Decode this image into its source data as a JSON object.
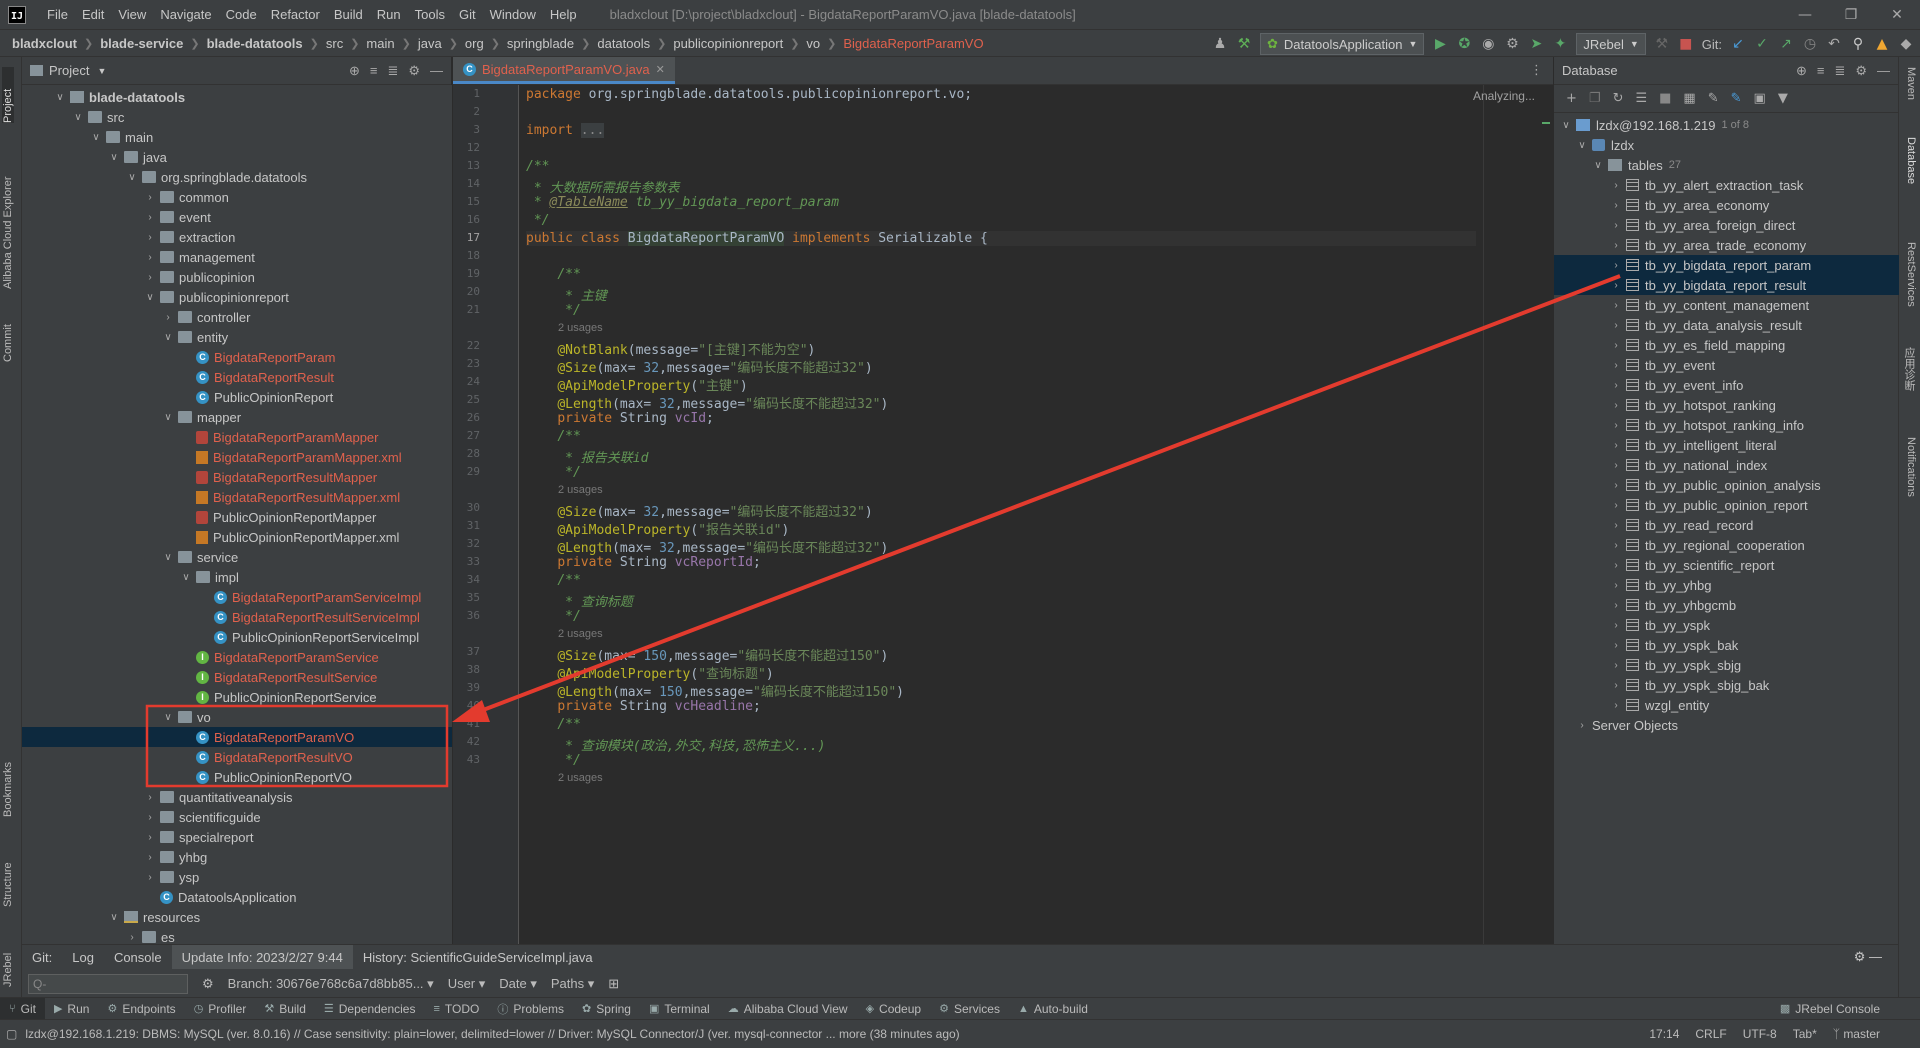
{
  "window": {
    "menu": [
      "File",
      "Edit",
      "View",
      "Navigate",
      "Code",
      "Refactor",
      "Build",
      "Run",
      "Tools",
      "Git",
      "Window",
      "Help"
    ],
    "title": "bladxclout [D:\\project\\bladxclout] - BigdataReportParamVO.java [blade-datatools]"
  },
  "breadcrumbs": [
    "bladxclout",
    "blade-service",
    "blade-datatools",
    "src",
    "main",
    "java",
    "org",
    "springblade",
    "datatools",
    "publicopinionreport",
    "vo",
    "BigdataReportParamVO"
  ],
  "toolbar": {
    "run_config": "DatatoolsApplication",
    "jrebel": "JRebel",
    "git_label": "Git:"
  },
  "left_strip": [
    "Project",
    "Alibaba Cloud Explorer",
    "Commit",
    "Bookmarks",
    "Structure",
    "JRebel"
  ],
  "right_strip": [
    "Maven",
    "Database",
    "RestServices",
    "应用诊断",
    "Notifications"
  ],
  "project": {
    "header": "Project",
    "tree": [
      {
        "label": "blade-datatools",
        "depth": 2,
        "arrow": "open",
        "icon": "module",
        "bold": true
      },
      {
        "label": "src",
        "depth": 3,
        "arrow": "open",
        "icon": "folder"
      },
      {
        "label": "main",
        "depth": 4,
        "arrow": "open",
        "icon": "folder"
      },
      {
        "label": "java",
        "depth": 5,
        "arrow": "open",
        "icon": "folder"
      },
      {
        "label": "org.springblade.datatools",
        "depth": 6,
        "arrow": "open",
        "icon": "package"
      },
      {
        "label": "common",
        "depth": 7,
        "arrow": "closed",
        "icon": "package"
      },
      {
        "label": "event",
        "depth": 7,
        "arrow": "closed",
        "icon": "package"
      },
      {
        "label": "extraction",
        "depth": 7,
        "arrow": "closed",
        "icon": "package"
      },
      {
        "label": "management",
        "depth": 7,
        "arrow": "closed",
        "icon": "package"
      },
      {
        "label": "publicopinion",
        "depth": 7,
        "arrow": "closed",
        "icon": "package"
      },
      {
        "label": "publicopinionreport",
        "depth": 7,
        "arrow": "open",
        "icon": "package"
      },
      {
        "label": "controller",
        "depth": 8,
        "arrow": "closed",
        "icon": "package"
      },
      {
        "label": "entity",
        "depth": 8,
        "arrow": "open",
        "icon": "package"
      },
      {
        "label": "BigdataReportParam",
        "depth": 9,
        "arrow": "none",
        "icon": "class",
        "modified": true
      },
      {
        "label": "BigdataReportResult",
        "depth": 9,
        "arrow": "none",
        "icon": "class",
        "modified": true
      },
      {
        "label": "PublicOpinionReport",
        "depth": 9,
        "arrow": "none",
        "icon": "class"
      },
      {
        "label": "mapper",
        "depth": 8,
        "arrow": "open",
        "icon": "package"
      },
      {
        "label": "BigdataReportParamMapper",
        "depth": 9,
        "arrow": "none",
        "icon": "mapper",
        "modified": true
      },
      {
        "label": "BigdataReportParamMapper.xml",
        "depth": 9,
        "arrow": "none",
        "icon": "xml",
        "modified": true
      },
      {
        "label": "BigdataReportResultMapper",
        "depth": 9,
        "arrow": "none",
        "icon": "mapper",
        "modified": true
      },
      {
        "label": "BigdataReportResultMapper.xml",
        "depth": 9,
        "arrow": "none",
        "icon": "xml",
        "modified": true
      },
      {
        "label": "PublicOpinionReportMapper",
        "depth": 9,
        "arrow": "none",
        "icon": "mapper"
      },
      {
        "label": "PublicOpinionReportMapper.xml",
        "depth": 9,
        "arrow": "none",
        "icon": "xml"
      },
      {
        "label": "service",
        "depth": 8,
        "arrow": "open",
        "icon": "package"
      },
      {
        "label": "impl",
        "depth": 9,
        "arrow": "open",
        "icon": "package"
      },
      {
        "label": "BigdataReportParamServiceImpl",
        "depth": 10,
        "arrow": "none",
        "icon": "class",
        "modified": true
      },
      {
        "label": "BigdataReportResultServiceImpl",
        "depth": 10,
        "arrow": "none",
        "icon": "class",
        "modified": true
      },
      {
        "label": "PublicOpinionReportServiceImpl",
        "depth": 10,
        "arrow": "none",
        "icon": "class"
      },
      {
        "label": "BigdataReportParamService",
        "depth": 9,
        "arrow": "none",
        "icon": "interface",
        "modified": true
      },
      {
        "label": "BigdataReportResultService",
        "depth": 9,
        "arrow": "none",
        "icon": "interface",
        "modified": true
      },
      {
        "label": "PublicOpinionReportService",
        "depth": 9,
        "arrow": "none",
        "icon": "interface"
      },
      {
        "label": "vo",
        "depth": 8,
        "arrow": "open",
        "icon": "package"
      },
      {
        "label": "BigdataReportParamVO",
        "depth": 9,
        "arrow": "none",
        "icon": "class",
        "modified": true,
        "selected": true
      },
      {
        "label": "BigdataReportResultVO",
        "depth": 9,
        "arrow": "none",
        "icon": "class",
        "modified": true
      },
      {
        "label": "PublicOpinionReportVO",
        "depth": 9,
        "arrow": "none",
        "icon": "class"
      },
      {
        "label": "quantitativeanalysis",
        "depth": 7,
        "arrow": "closed",
        "icon": "package"
      },
      {
        "label": "scientificguide",
        "depth": 7,
        "arrow": "closed",
        "icon": "package"
      },
      {
        "label": "specialreport",
        "depth": 7,
        "arrow": "closed",
        "icon": "package"
      },
      {
        "label": "yhbg",
        "depth": 7,
        "arrow": "closed",
        "icon": "package"
      },
      {
        "label": "ysp",
        "depth": 7,
        "arrow": "closed",
        "icon": "package"
      },
      {
        "label": "DatatoolsApplication",
        "depth": 7,
        "arrow": "none",
        "icon": "class"
      },
      {
        "label": "resources",
        "depth": 5,
        "arrow": "open",
        "icon": "resources"
      },
      {
        "label": "es",
        "depth": 6,
        "arrow": "closed",
        "icon": "folder"
      }
    ]
  },
  "editor": {
    "tab": "BigdataReportParamVO.java",
    "status": "Analyzing...",
    "usages_label": "2 usages",
    "lines": [
      {
        "n": "1",
        "html": "<span class=\"kw\">package</span> org.springblade.datatools.publicopinionreport.vo;"
      },
      {
        "n": "2",
        "html": ""
      },
      {
        "n": "3",
        "html": "<span class=\"kw\">import</span> <span style=\"background:#3b3f41;color:#888\">...</span>"
      },
      {
        "n": "12",
        "html": ""
      },
      {
        "n": "13",
        "html": "<span class=\"cmt\">/**</span>"
      },
      {
        "n": "14",
        "html": "<span class=\"cmt\"> * 大数据所需报告参数表</span>"
      },
      {
        "n": "15",
        "html": "<span class=\"cmt\"> * <u style=\"color:#8a8a5a\">@TableName</u> tb_yy_bigdata_report_param</span>"
      },
      {
        "n": "16",
        "html": "<span class=\"cmt\"> */</span>"
      },
      {
        "n": "17",
        "html": "<span class=\"kw\">public class</span> <span style=\"background:#344134\">BigdataReportParamVO</span> <span class=\"kw\">implements</span> Serializable {",
        "cur": true
      },
      {
        "n": "18",
        "html": ""
      },
      {
        "n": "19",
        "html": "    <span class=\"cmt\">/**</span>"
      },
      {
        "n": "20",
        "html": "<span class=\"cmt\">     * 主键</span>"
      },
      {
        "n": "21",
        "html": "<span class=\"cmt\">     */</span>",
        "usages_after": true
      },
      {
        "n": "22",
        "html": "    <span class=\"ann\">@NotBlank</span>(message=<span class=\"str\">\"[主键]不能为空\"</span>)"
      },
      {
        "n": "23",
        "html": "    <span class=\"ann\">@Size</span>(max= <span class=\"num\">32</span>,message=<span class=\"str\">\"编码长度不能超过32\"</span>)"
      },
      {
        "n": "24",
        "html": "    <span class=\"ann\">@ApiModelProperty</span>(<span class=\"str\">\"主键\"</span>)"
      },
      {
        "n": "25",
        "html": "    <span class=\"ann\">@Length</span>(max= <span class=\"num\">32</span>,message=<span class=\"str\">\"编码长度不能超过32\"</span>)"
      },
      {
        "n": "26",
        "html": "    <span class=\"kw\">private</span> String <span class=\"fld\">vcId</span>;"
      },
      {
        "n": "27",
        "html": "    <span class=\"cmt\">/**</span>"
      },
      {
        "n": "28",
        "html": "<span class=\"cmt\">     * 报告关联id</span>"
      },
      {
        "n": "29",
        "html": "<span class=\"cmt\">     */</span>",
        "usages_after": true
      },
      {
        "n": "30",
        "html": "    <span class=\"ann\">@Size</span>(max= <span class=\"num\">32</span>,message=<span class=\"str\">\"编码长度不能超过32\"</span>)"
      },
      {
        "n": "31",
        "html": "    <span class=\"ann\">@ApiModelProperty</span>(<span class=\"str\">\"报告关联id\"</span>)"
      },
      {
        "n": "32",
        "html": "    <span class=\"ann\">@Length</span>(max= <span class=\"num\">32</span>,message=<span class=\"str\">\"编码长度不能超过32\"</span>)"
      },
      {
        "n": "33",
        "html": "    <span class=\"kw\">private</span> String <span class=\"fld\">vcReportId</span>;"
      },
      {
        "n": "34",
        "html": "    <span class=\"cmt\">/**</span>"
      },
      {
        "n": "35",
        "html": "<span class=\"cmt\">     * 查询标题</span>"
      },
      {
        "n": "36",
        "html": "<span class=\"cmt\">     */</span>",
        "usages_after": true
      },
      {
        "n": "37",
        "html": "    <span class=\"ann\">@Size</span>(max= <span class=\"num\">150</span>,message=<span class=\"str\">\"编码长度不能超过150\"</span>)"
      },
      {
        "n": "38",
        "html": "    <span class=\"ann\">@ApiModelProperty</span>(<span class=\"str\">\"查询标题\"</span>)"
      },
      {
        "n": "39",
        "html": "    <span class=\"ann\">@Length</span>(max= <span class=\"num\">150</span>,message=<span class=\"str\">\"编码长度不能超过150\"</span>)"
      },
      {
        "n": "40",
        "html": "    <span class=\"kw\">private</span> String <span class=\"fld\">vcHeadline</span>;"
      },
      {
        "n": "41",
        "html": "    <span class=\"cmt\">/**</span>"
      },
      {
        "n": "42",
        "html": "<span class=\"cmt\">     * 查询模块(政治,外交,科技,恐怖主义...)</span>"
      },
      {
        "n": "43",
        "html": "<span class=\"cmt\">     */</span>",
        "usages_after": true
      }
    ]
  },
  "database": {
    "header": "Database",
    "connection": "lzdx@192.168.1.219",
    "connection_count": "1 of 8",
    "schema": "lzdx",
    "tables_label": "tables",
    "tables_count": "27",
    "tables": [
      "tb_yy_alert_extraction_task",
      "tb_yy_area_economy",
      "tb_yy_area_foreign_direct",
      "tb_yy_area_trade_economy",
      "tb_yy_bigdata_report_param",
      "tb_yy_bigdata_report_result",
      "tb_yy_content_management",
      "tb_yy_data_analysis_result",
      "tb_yy_es_field_mapping",
      "tb_yy_event",
      "tb_yy_event_info",
      "tb_yy_hotspot_ranking",
      "tb_yy_hotspot_ranking_info",
      "tb_yy_intelligent_literal",
      "tb_yy_national_index",
      "tb_yy_public_opinion_analysis",
      "tb_yy_public_opinion_report",
      "tb_yy_read_record",
      "tb_yy_regional_cooperation",
      "tb_yy_scientific_report",
      "tb_yy_yhbg",
      "tb_yy_yhbgcmb",
      "tb_yy_yspk",
      "tb_yy_yspk_bak",
      "tb_yy_yspk_sbjg",
      "tb_yy_yspk_sbjg_bak",
      "wzgl_entity"
    ],
    "selected_tables": [
      "tb_yy_bigdata_report_param",
      "tb_yy_bigdata_report_result"
    ],
    "server_objects": "Server Objects"
  },
  "bottom": {
    "tabs": [
      "Git:",
      "Log",
      "Console",
      "Update Info: 2023/2/27 9:44",
      "History: ScientificGuideServiceImpl.java"
    ],
    "search_placeholder": "Q-",
    "branch": "Branch: 30676e768c6a7d8bb85...",
    "filters": [
      "User",
      "Date",
      "Paths"
    ]
  },
  "toolwindows": [
    "Git",
    "Run",
    "Endpoints",
    "Profiler",
    "Build",
    "Dependencies",
    "TODO",
    "Problems",
    "Spring",
    "Terminal",
    "Alibaba Cloud View",
    "Codeup",
    "Services",
    "Auto-build"
  ],
  "toolwindow_right": "JRebel Console",
  "status": {
    "message": "lzdx@192.168.1.219: DBMS: MySQL (ver. 8.0.16) // Case sensitivity: plain=lower, delimited=lower // Driver: MySQL Connector/J (ver. mysql-connector ... more (38 minutes ago)",
    "position": "17:14",
    "line_sep": "CRLF",
    "encoding": "UTF-8",
    "indent": "Tab*",
    "branch": "master"
  },
  "colors": {
    "modified": "#e0614d",
    "selection": "#0d293e",
    "annotation_red": "#e33b2e"
  }
}
